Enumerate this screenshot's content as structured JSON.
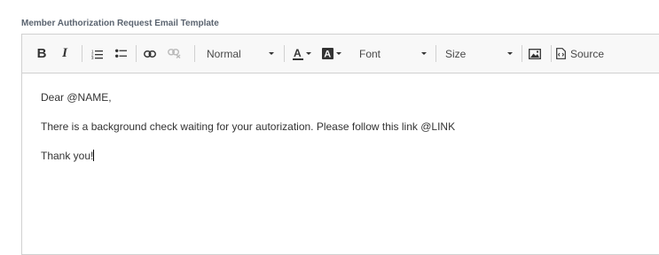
{
  "field_label": "Member Authorization Request Email Template",
  "toolbar": {
    "bold_label": "B",
    "italic_label": "I",
    "format_value": "Normal",
    "font_value": "Font",
    "size_value": "Size",
    "source_label": "Source"
  },
  "icons": [
    "bold-icon",
    "italic-icon",
    "numbered-list-icon",
    "bulleted-list-icon",
    "link-icon",
    "unlink-icon",
    "text-color-icon",
    "background-color-icon",
    "image-icon",
    "source-icon",
    "chevron-down-icon"
  ],
  "content": {
    "greeting": "Dear @NAME,",
    "body": "There is a background check waiting for your autorization. Please follow this link @LINK",
    "closing": "Thank you!"
  }
}
